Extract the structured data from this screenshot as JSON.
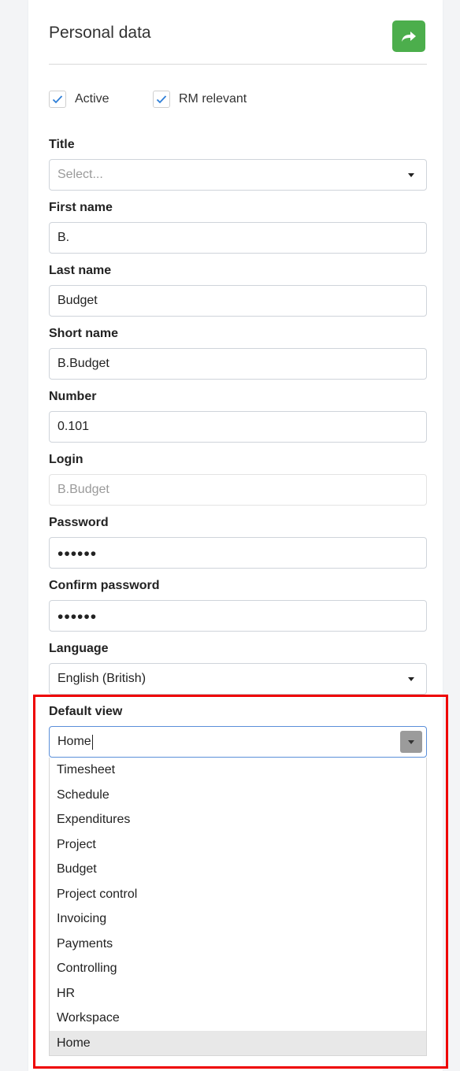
{
  "panel": {
    "title": "Personal data",
    "share_icon": "share-arrow-icon",
    "accent_color": "#4cae4c"
  },
  "checkboxes": [
    {
      "label": "Active",
      "checked": true
    },
    {
      "label": "RM relevant",
      "checked": true
    }
  ],
  "fields": {
    "title": {
      "label": "Title",
      "placeholder": "Select..."
    },
    "first_name": {
      "label": "First name",
      "value": "B."
    },
    "last_name": {
      "label": "Last name",
      "value": "Budget"
    },
    "short_name": {
      "label": "Short name",
      "value": "B.Budget"
    },
    "number": {
      "label": "Number",
      "value": "0.101"
    },
    "login": {
      "label": "Login",
      "value": "B.Budget"
    },
    "password": {
      "label": "Password",
      "value": "••••••"
    },
    "confirm_password": {
      "label": "Confirm password",
      "value": "••••••"
    },
    "language": {
      "label": "Language",
      "value": "English (British)"
    }
  },
  "default_view": {
    "label": "Default view",
    "value": "Home",
    "options": [
      "Timesheet",
      "Schedule",
      "Expenditures",
      "Project",
      "Budget",
      "Project control",
      "Invoicing",
      "Payments",
      "Controlling",
      "HR",
      "Workspace",
      "Home"
    ],
    "selected": "Home",
    "highlight_color": "#ee0000"
  }
}
